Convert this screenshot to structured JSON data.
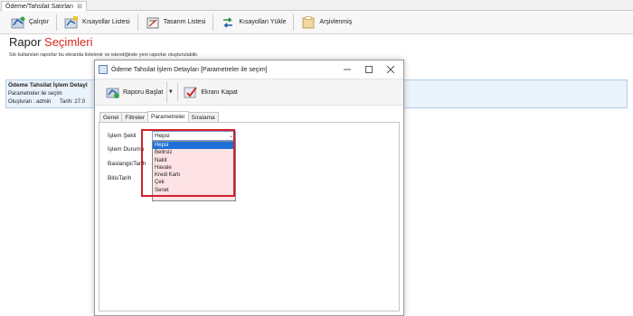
{
  "doc_tab": {
    "label": "Ödeme/Tahsilat Satırları",
    "close": "⊠"
  },
  "toolbar": {
    "items": [
      {
        "label": "Çalıştır"
      },
      {
        "label": "Kısayollar Listesi"
      },
      {
        "label": "Tasarım Listesi"
      },
      {
        "label": "Kısayolları Yükle"
      },
      {
        "label": "Arşivlenmiş"
      }
    ]
  },
  "header": {
    "title_plain": "Rapor ",
    "title_accent": "Seçimleri",
    "subtitle": "Sık kullanılan raporlar bu ekranda listelenir ve istendiğinde yeni raporlar oluşturulabilir."
  },
  "card": {
    "title": "Ödeme Tahsilat İşlem Detayl",
    "subtitle": "Parametreler ile seçim",
    "created": "Oluşturan : admin",
    "date": "Tarih: 27.0"
  },
  "dialog": {
    "title": "Ödeme Tahsilat İşlem Detayları [Parametreler ile seçim]",
    "buttons": {
      "start": "Raporu Başlat",
      "close": "Ekranı Kapat"
    },
    "tabs": [
      "Genel",
      "Filtreler",
      "Parametreler",
      "Sıralama"
    ],
    "active_tab": "Parametreler",
    "fields": [
      "İşlem Şekli",
      "İşlem Durumu",
      "BaslangicTarih",
      "BitisTarih"
    ],
    "combo_value": "Hepsi",
    "options": [
      "Hepsi",
      "Belirsiz",
      "Nakit",
      "Havale",
      "Kredi Kartı",
      "Çek",
      "Senet"
    ],
    "selected_option": "Hepsi"
  },
  "colors": {
    "accent": "#d4281f",
    "highlight": "#d01f2a",
    "selection": "#1e6fd9",
    "dropdown_bg": "#fde3e5",
    "card_bg": "#eaf2fb"
  },
  "icons": {
    "run": "run-icon",
    "shortcuts": "shortcut-list-icon",
    "designs": "design-list-icon",
    "load": "load-shortcuts-icon",
    "archive": "archive-icon",
    "start": "start-report-icon",
    "close": "close-screen-icon"
  }
}
